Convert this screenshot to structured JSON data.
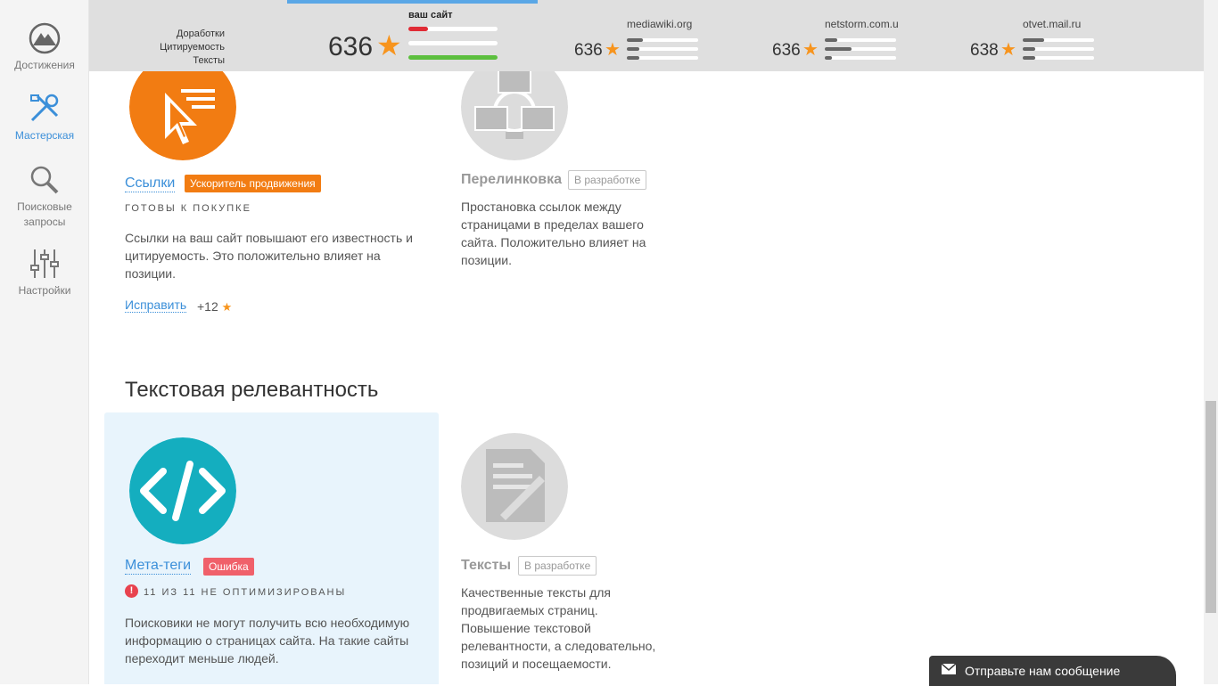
{
  "sidebar": {
    "items": [
      {
        "label": "Достижения",
        "icon": "mountain-icon"
      },
      {
        "label": "Мастерская",
        "icon": "tools-icon",
        "active": true
      },
      {
        "label_line1": "Поисковые",
        "label_line2": "запросы",
        "icon": "search-icon"
      },
      {
        "label": "Настройки",
        "icon": "sliders-icon"
      }
    ]
  },
  "topbar": {
    "legend": [
      "Доработки",
      "Цитируемость",
      "Тексты"
    ],
    "own": {
      "label": "ваш сайт",
      "score": "636"
    },
    "competitors": [
      {
        "name": "mediawiki.org",
        "score": "636"
      },
      {
        "name": "netstorm.com.ua",
        "score": "636"
      },
      {
        "name": "otvet.mail.ru",
        "score": "638"
      }
    ]
  },
  "cards": {
    "links": {
      "title": "Ссылки",
      "badge": "Ускоритель продвижения",
      "status": "готовы к покупке",
      "description": "Ссылки на ваш сайт повышают его известность и цитируемость. Это положительно влияет на позиции.",
      "fix_label": "Исправить",
      "bonus": "+12"
    },
    "interlinking": {
      "title": "Перелинковка",
      "badge": "В разработке",
      "description": "Простановка ссылок между страницами в пределах вашего сайта. Положительно влияет на позиции."
    },
    "meta": {
      "title": "Мета-теги",
      "badge": "Ошибка",
      "status": "11 из 11 не оптимизированы",
      "description": "Поисковики не могут получить всю необходимую информацию о страницах сайта. На такие сайты переходит меньше людей."
    },
    "texts": {
      "title": "Тексты",
      "badge": "В разработке",
      "description": "Качественные тексты для продвигаемых страниц. Повышение текстовой релевантности, а следовательно, позиций и посещаемости."
    }
  },
  "section": {
    "title": "Текстовая релевантность"
  },
  "widget": {
    "label": "Отправьте нам сообщение"
  },
  "colors": {
    "accent": "#3b8fd9",
    "orange": "#f27c12",
    "teal": "#14aebf",
    "error": "#f0606a"
  }
}
